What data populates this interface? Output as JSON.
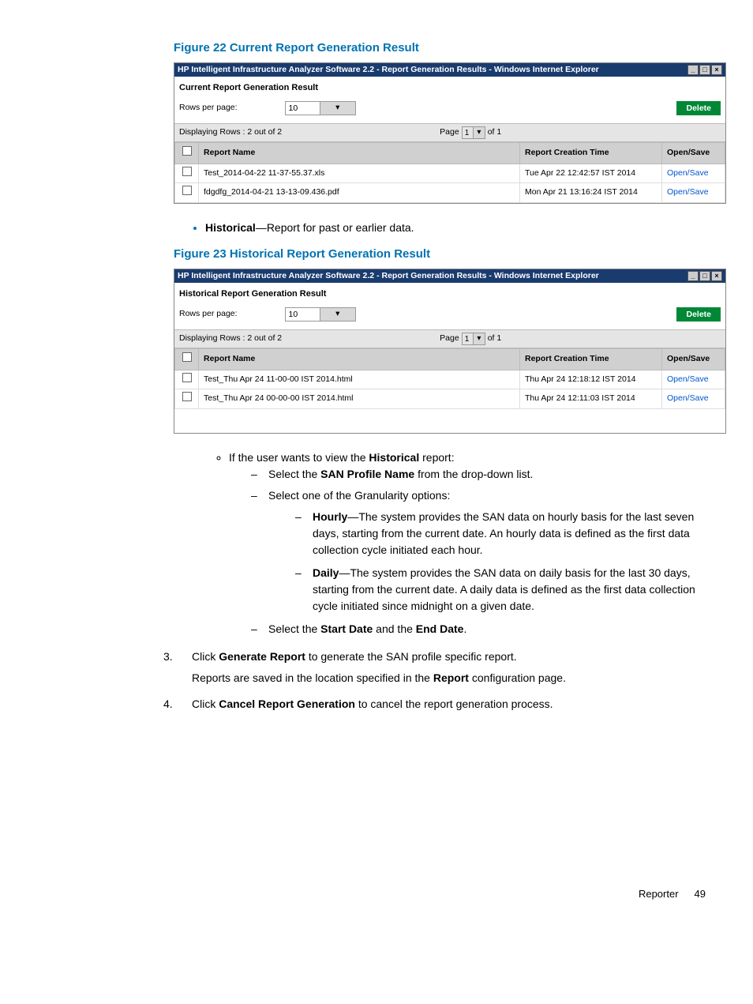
{
  "figure22": {
    "caption": "Figure 22 Current Report Generation Result",
    "window_title": "HP Intelligent Infrastructure Analyzer Software 2.2 - Report Generation Results - Windows Internet Explorer",
    "subheader": "Current Report Generation Result",
    "rows_per_page_label": "Rows per page:",
    "rows_per_page_value": "10",
    "delete_label": "Delete",
    "displaying": "Displaying Rows : 2 out of 2",
    "page_label_pre": "Page",
    "page_value": "1",
    "page_label_post": "of 1",
    "headers": {
      "name": "Report Name",
      "time": "Report Creation Time",
      "action": "Open/Save"
    },
    "rows": [
      {
        "name": "Test_2014-04-22 11-37-55.37.xls",
        "time": "Tue Apr 22 12:42:57 IST 2014",
        "action": "Open/Save"
      },
      {
        "name": "fdgdfg_2014-04-21 13-13-09.436.pdf",
        "time": "Mon Apr 21 13:16:24 IST 2014",
        "action": "Open/Save"
      }
    ]
  },
  "historical_bullet": {
    "term": "Historical",
    "rest": "—Report for past or earlier data."
  },
  "figure23": {
    "caption": "Figure 23 Historical Report Generation Result",
    "window_title": "HP Intelligent Infrastructure Analyzer Software 2.2 - Report Generation Results - Windows Internet Explorer",
    "subheader": "Historical Report Generation Result",
    "rows_per_page_label": "Rows per page:",
    "rows_per_page_value": "10",
    "delete_label": "Delete",
    "displaying": "Displaying Rows : 2 out of 2",
    "page_label_pre": "Page",
    "page_value": "1",
    "page_label_post": "of 1",
    "headers": {
      "name": "Report Name",
      "time": "Report Creation Time",
      "action": "Open/Save"
    },
    "rows": [
      {
        "name": "Test_Thu Apr 24 11-00-00 IST 2014.html",
        "time": "Thu Apr 24 12:18:12 IST 2014",
        "action": "Open/Save"
      },
      {
        "name": "Test_Thu Apr 24 00-00-00 IST 2014.html",
        "time": "Thu Apr 24 12:11:03 IST 2014",
        "action": "Open/Save"
      }
    ]
  },
  "instructions": {
    "circ_intro_pre": "If the user wants to view the ",
    "circ_intro_bold": "Historical",
    "circ_intro_post": " report:",
    "step_a_pre": "Select the ",
    "step_a_bold": "SAN Profile Name",
    "step_a_post": " from the drop-down list.",
    "step_b": "Select one of the Granularity options:",
    "hourly_term": "Hourly",
    "hourly_rest": "—The system provides the SAN data on hourly basis for the last seven days, starting from the current date. An hourly data is defined as the first data collection cycle initiated each hour.",
    "daily_term": "Daily",
    "daily_rest": "—The system provides the SAN data on daily basis for the last 30 days, starting from the current date. A daily data is defined as the first data collection cycle initiated since midnight on a given date.",
    "step_c_pre": "Select the ",
    "step_c_bold1": "Start Date",
    "step_c_mid": " and the ",
    "step_c_bold2": "End Date",
    "step_c_post": ".",
    "step3_pre": "Click ",
    "step3_bold": "Generate Report",
    "step3_post": " to generate the SAN profile specific report.",
    "step3_line2_pre": "Reports are saved in the location specified in the ",
    "step3_line2_bold": "Report",
    "step3_line2_post": " configuration page.",
    "step4_pre": "Click ",
    "step4_bold": "Cancel Report Generation",
    "step4_post": " to cancel the report generation process."
  },
  "footer": {
    "section": "Reporter",
    "page": "49"
  }
}
